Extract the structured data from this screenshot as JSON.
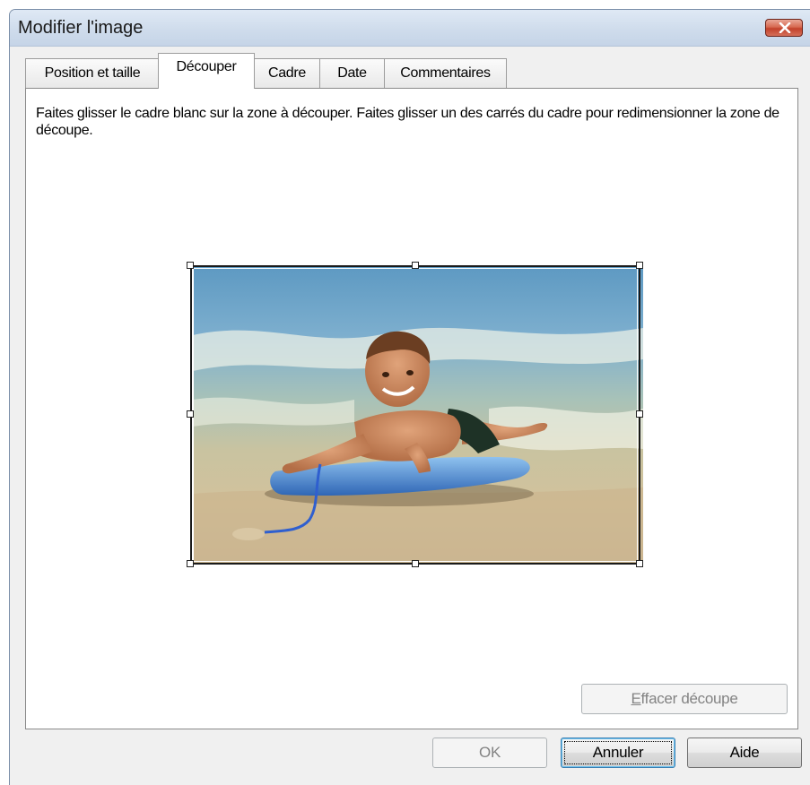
{
  "window": {
    "title": "Modifier l'image"
  },
  "tabs": [
    {
      "label": "Position et taille",
      "active": false
    },
    {
      "label": "Découper",
      "active": true
    },
    {
      "label": "Cadre",
      "active": false
    },
    {
      "label": "Date",
      "active": false
    },
    {
      "label": "Commentaires",
      "active": false
    }
  ],
  "panel": {
    "instruction": "Faites glisser le cadre blanc sur la zone à découper. Faites glisser un des carrés du cadre pour redimensionner la zone de découpe.",
    "clear_crop_button": {
      "label": "Effacer découpe",
      "mnemonic": "E",
      "rest": "ffacer découpe",
      "enabled": false
    }
  },
  "footer": {
    "ok_label": "OK",
    "cancel_label": "Annuler",
    "help_label": "Aide"
  },
  "colors": {
    "accent_close": "#c2402a",
    "default_button_border": "#3c7fb1"
  }
}
